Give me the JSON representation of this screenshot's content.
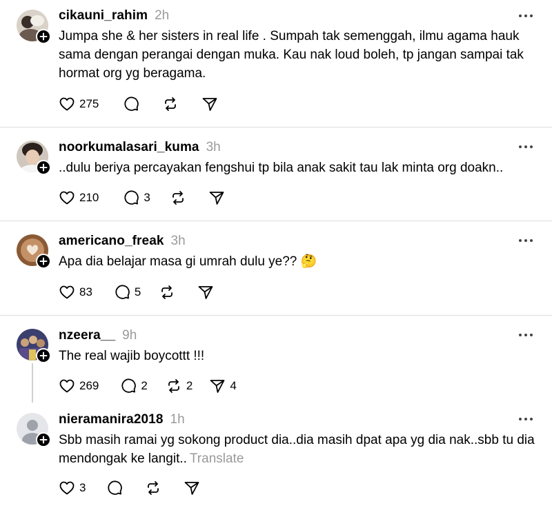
{
  "posts": [
    {
      "username": "cikauni_rahim",
      "time": "2h",
      "text": "Jumpa she & her sisters in real life . Sumpah tak semenggah, ilmu agama hauk sama dengan perangai dengan muka. Kau nak loud boleh, tp jangan sampai tak hormat org yg beragama.",
      "likes": "275",
      "replies": "",
      "reposts": "",
      "shares": ""
    },
    {
      "username": "noorkumalasari_kuma",
      "time": "3h",
      "text": "..dulu beriya percayakan fengshui tp bila anak sakit tau lak minta org doakn..",
      "likes": "210",
      "replies": "3",
      "reposts": "",
      "shares": ""
    },
    {
      "username": "americano_freak",
      "time": "3h",
      "text": "Apa dia belajar masa gi umrah dulu ye?? 🤔",
      "likes": "83",
      "replies": "5",
      "reposts": "",
      "shares": ""
    },
    {
      "username": "nzeera__",
      "time": "9h",
      "text": "The real wajib boycottt !!!",
      "likes": "269",
      "replies": "2",
      "reposts": "2",
      "shares": "4"
    },
    {
      "username": "nieramanira2018",
      "time": "1h",
      "text": "Sbb masih ramai yg sokong product dia..dia masih dpat apa yg dia nak..sbb tu dia mendongak ke langit..",
      "translate": "Translate",
      "likes": "3",
      "replies": "",
      "reposts": "",
      "shares": ""
    }
  ],
  "icons": {
    "like": "heart-icon",
    "reply": "comment-icon",
    "repost": "repost-icon",
    "share": "send-icon",
    "more": "more-icon",
    "follow": "plus-icon"
  },
  "colors": {
    "text": "#000000",
    "muted": "#9a9a9a",
    "divider": "#dcdcdc"
  }
}
